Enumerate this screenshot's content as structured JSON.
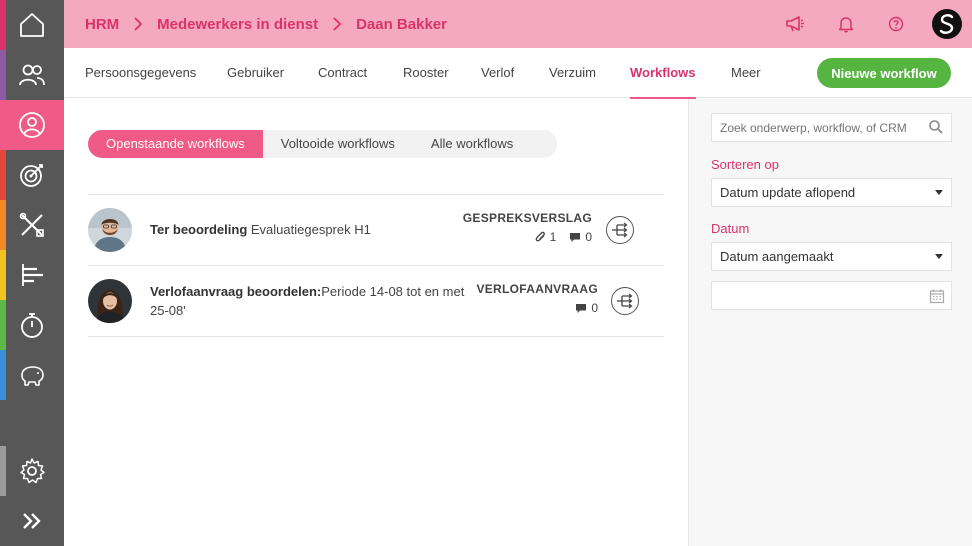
{
  "colors": {
    "accent": "#ef5b86",
    "accent_dark": "#d9336a",
    "header_bg": "#f4a9c0",
    "green": "#56b540",
    "sidebar_bg": "#575757"
  },
  "sidebar": {
    "items": [
      {
        "icon": "home-icon"
      },
      {
        "icon": "users-icon"
      },
      {
        "icon": "user-icon"
      },
      {
        "icon": "target-icon"
      },
      {
        "icon": "tools-icon"
      },
      {
        "icon": "schedule-icon"
      },
      {
        "icon": "stopwatch-icon"
      },
      {
        "icon": "piggy-bank-icon"
      },
      {
        "icon": "settings-icon"
      },
      {
        "icon": "expand-icon"
      }
    ]
  },
  "header": {
    "breadcrumb": [
      "HRM",
      "Medewerkers in dienst",
      "Daan Bakker"
    ],
    "icons": [
      "megaphone-icon",
      "bell-icon",
      "help-icon"
    ]
  },
  "tabs": {
    "items": [
      "Persoonsgegevens",
      "Gebruiker",
      "Contract",
      "Rooster",
      "Verlof",
      "Verzuim",
      "Workflows",
      "Meer"
    ],
    "active": "Workflows",
    "new_button": "Nieuwe workflow"
  },
  "filters": {
    "segments": [
      "Openstaande workflows",
      "Voltooide workflows",
      "Alle workflows"
    ],
    "active": "Openstaande workflows"
  },
  "workflows": [
    {
      "title": "Ter beoordeling",
      "subject": "Evaluatiegesprek H1",
      "type": "GESPREKSVERSLAG",
      "attachments": "1",
      "comments": "0"
    },
    {
      "title": "Verlofaanvraag beoordelen:",
      "subject": "Periode 14-08 tot en met 25-08'",
      "type": "VERLOFAANVRAAG",
      "comments": "0"
    }
  ],
  "panel": {
    "search_placeholder": "Zoek onderwerp, workflow, of CRM",
    "sort_label": "Sorteren op",
    "sort_value": "Datum update aflopend",
    "date_label": "Datum",
    "date_value": "Datum aangemaakt",
    "date_input_value": ""
  }
}
